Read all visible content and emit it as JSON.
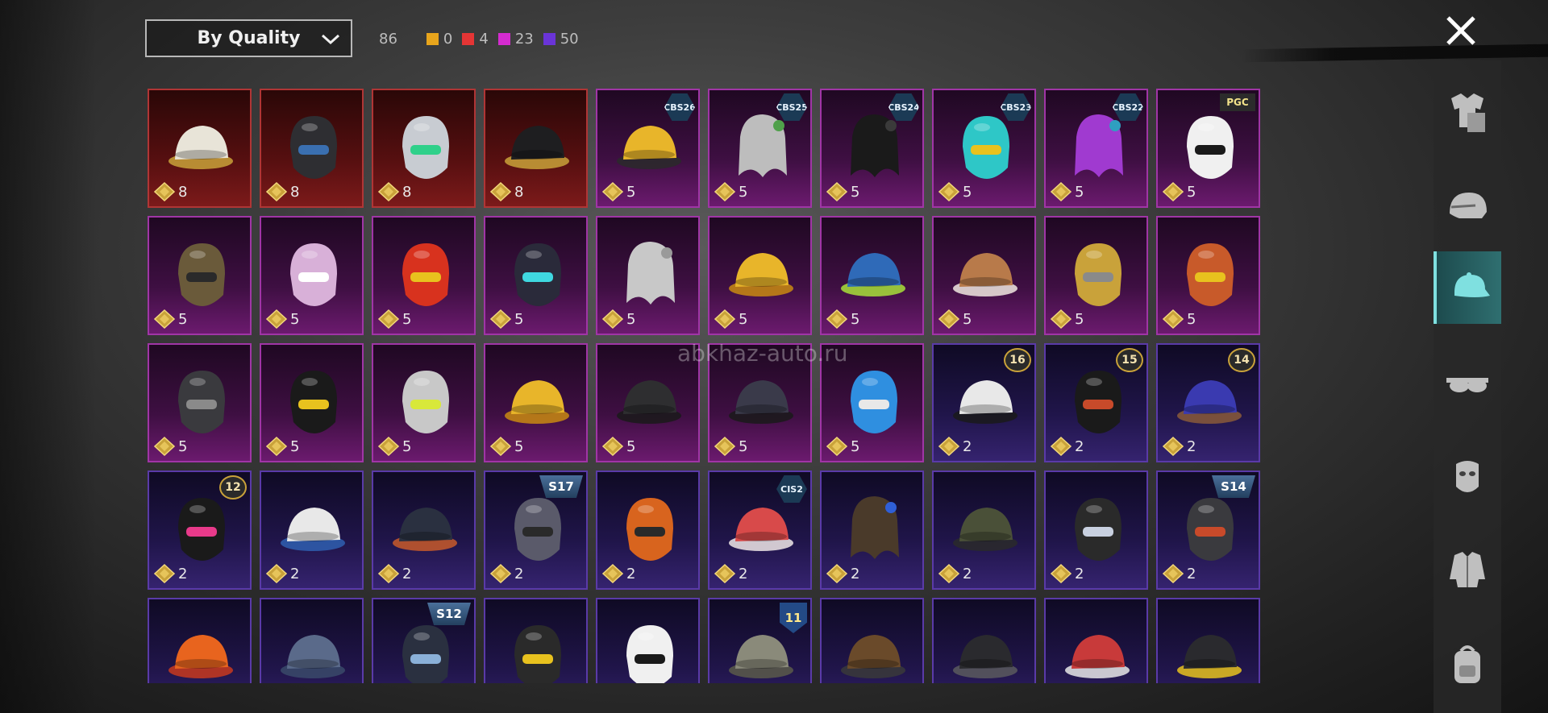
{
  "sort": {
    "label": "By Quality"
  },
  "stats": {
    "total": "86",
    "items": [
      {
        "color": "#e8a51c",
        "count": "0"
      },
      {
        "color": "#e53535",
        "count": "4"
      },
      {
        "color": "#d42bd0",
        "count": "23"
      },
      {
        "color": "#6a34d8",
        "count": "50"
      }
    ]
  },
  "watermark": "abkhaz-auto.ru",
  "rail": [
    {
      "name": "outfit-icon",
      "active": false
    },
    {
      "name": "helmet-icon",
      "active": false
    },
    {
      "name": "cap-icon",
      "active": true
    },
    {
      "name": "goggles-icon",
      "active": false
    },
    {
      "name": "mask-icon",
      "active": false
    },
    {
      "name": "jacket-icon",
      "active": false
    },
    {
      "name": "backpack-icon",
      "active": false
    }
  ],
  "items": [
    {
      "tier": "red",
      "qty": "8",
      "icon": "cowboy-hat",
      "color": "#e8e4d8",
      "accent": "#c9a23a",
      "badge": null
    },
    {
      "tier": "red",
      "qty": "8",
      "icon": "tactical-helmet",
      "color": "#2e2e32",
      "accent": "#3a6fb0",
      "badge": null
    },
    {
      "tier": "red",
      "qty": "8",
      "icon": "knight-helmet",
      "color": "#c8ccd2",
      "accent": "#2fd08a",
      "badge": null
    },
    {
      "tier": "red",
      "qty": "8",
      "icon": "bicorne-hat",
      "color": "#1e1e20",
      "accent": "#c9a23a",
      "badge": null
    },
    {
      "tier": "pink",
      "qty": "5",
      "icon": "bee-hat",
      "color": "#e8b52a",
      "accent": "#2a2a2a",
      "badge": {
        "type": "hex",
        "text": "CBS26"
      }
    },
    {
      "tier": "pink",
      "qty": "5",
      "icon": "silver-hair",
      "color": "#bdbdbd",
      "accent": "#4fa04a",
      "badge": {
        "type": "hex",
        "text": "CBS25"
      }
    },
    {
      "tier": "pink",
      "qty": "5",
      "icon": "black-hair",
      "color": "#1a1a1a",
      "accent": "#3a3a3a",
      "badge": {
        "type": "hex",
        "text": "CBS24"
      }
    },
    {
      "tier": "pink",
      "qty": "5",
      "icon": "cat-headphones",
      "color": "#2ec7c7",
      "accent": "#e8c21e",
      "badge": {
        "type": "hex",
        "text": "CBS23"
      }
    },
    {
      "tier": "pink",
      "qty": "5",
      "icon": "purple-hair",
      "color": "#a03ad0",
      "accent": "#2f9fc0",
      "badge": {
        "type": "hex",
        "text": "CBS22"
      }
    },
    {
      "tier": "pink",
      "qty": "5",
      "icon": "panda-mask",
      "color": "#f0f0f0",
      "accent": "#1a1a1a",
      "badge": {
        "type": "pgc",
        "text": "PGC"
      }
    },
    {
      "tier": "pink",
      "qty": "5",
      "icon": "feather-ornament",
      "color": "#6a5a3a",
      "accent": "#2a2a2a",
      "badge": null
    },
    {
      "tier": "pink",
      "qty": "5",
      "icon": "bunny-hood",
      "color": "#d8b0d8",
      "accent": "#ffffff",
      "badge": null
    },
    {
      "tier": "pink",
      "qty": "5",
      "icon": "samurai-helmet",
      "color": "#d8321e",
      "accent": "#e8c21e",
      "badge": null
    },
    {
      "tier": "pink",
      "qty": "5",
      "icon": "crystal-headpiece",
      "color": "#2a2a3a",
      "accent": "#3fd8e0",
      "badge": null
    },
    {
      "tier": "pink",
      "qty": "5",
      "icon": "gray-long-hair",
      "color": "#c8c8c8",
      "accent": "#9a9a9a",
      "badge": null
    },
    {
      "tier": "pink",
      "qty": "5",
      "icon": "yellow-bucket-hat",
      "color": "#e8b52a",
      "accent": "#c98a12",
      "badge": null
    },
    {
      "tier": "pink",
      "qty": "5",
      "icon": "frog-hat",
      "color": "#2f6ab8",
      "accent": "#a8e03a",
      "badge": null
    },
    {
      "tier": "pink",
      "qty": "5",
      "icon": "bear-beanie",
      "color": "#b87a4a",
      "accent": "#f0e8e0",
      "badge": null
    },
    {
      "tier": "pink",
      "qty": "5",
      "icon": "golden-mask-helmet",
      "color": "#c9a23a",
      "accent": "#8a8a8a",
      "badge": null
    },
    {
      "tier": "pink",
      "qty": "5",
      "icon": "red-turban",
      "color": "#c85a2a",
      "accent": "#e8c21e",
      "badge": null
    },
    {
      "tier": "pink",
      "qty": "5",
      "icon": "armored-helmet",
      "color": "#3a3a3e",
      "accent": "#8a8a8a",
      "badge": null
    },
    {
      "tier": "pink",
      "qty": "5",
      "icon": "cat-king-helmet",
      "color": "#1a1a1a",
      "accent": "#e8c21e",
      "badge": null
    },
    {
      "tier": "pink",
      "qty": "5",
      "icon": "ponytail-goggles",
      "color": "#c8c8c8",
      "accent": "#d8e83a",
      "badge": null
    },
    {
      "tier": "pink",
      "qty": "5",
      "icon": "yellow-bucket-hat-2",
      "color": "#e8b52a",
      "accent": "#c98a12",
      "badge": null
    },
    {
      "tier": "pink",
      "qty": "5",
      "icon": "witch-hat",
      "color": "#2e2e30",
      "accent": "#1a1a1a",
      "badge": null
    },
    {
      "tier": "pink",
      "qty": "5",
      "icon": "spiky-hair-cap",
      "color": "#3a3a4a",
      "accent": "#1a1a1a",
      "badge": null
    },
    {
      "tier": "pink",
      "qty": "5",
      "icon": "blue-spiky-mask",
      "color": "#2f8fe0",
      "accent": "#e8e8e8",
      "badge": null
    },
    {
      "tier": "purple",
      "qty": "2",
      "icon": "snow-beanie",
      "color": "#e8e8e8",
      "accent": "#1a1a1a",
      "badge": {
        "type": "num",
        "text": "16"
      }
    },
    {
      "tier": "purple",
      "qty": "2",
      "icon": "pumpkin-hood",
      "color": "#1a1a1a",
      "accent": "#c84a2a",
      "badge": {
        "type": "num",
        "text": "15"
      }
    },
    {
      "tier": "purple",
      "qty": "2",
      "icon": "cap-long-hair",
      "color": "#3a3ab0",
      "accent": "#8a5a3a",
      "badge": {
        "type": "num",
        "text": "14"
      }
    },
    {
      "tier": "purple",
      "qty": "2",
      "icon": "bunny-ears-helmet",
      "color": "#1a1a1a",
      "accent": "#e83a8a",
      "badge": {
        "type": "num",
        "text": "12"
      }
    },
    {
      "tier": "purple",
      "qty": "2",
      "icon": "baseball-cap",
      "color": "#e8e8e8",
      "accent": "#2f5fb0",
      "badge": null
    },
    {
      "tier": "purple",
      "qty": "2",
      "icon": "navy-beanie",
      "color": "#2a3040",
      "accent": "#c85a2a",
      "badge": null
    },
    {
      "tier": "purple",
      "qty": "2",
      "icon": "horned-helmet",
      "color": "#5a5a6a",
      "accent": "#2a2a2a",
      "badge": {
        "type": "season",
        "text": "S17"
      }
    },
    {
      "tier": "purple",
      "qty": "2",
      "icon": "pumpkin-mask",
      "color": "#d8641e",
      "accent": "#2a2a2a",
      "badge": null
    },
    {
      "tier": "purple",
      "qty": "2",
      "icon": "striped-beanie",
      "color": "#d84a4a",
      "accent": "#f0e8e8",
      "badge": {
        "type": "hex",
        "text": "CIS2"
      }
    },
    {
      "tier": "purple",
      "qty": "2",
      "icon": "brown-hair",
      "color": "#4a3a2a",
      "accent": "#2f5fd8",
      "badge": null
    },
    {
      "tier": "purple",
      "qty": "2",
      "icon": "military-cap",
      "color": "#4a5038",
      "accent": "#2a2a2a",
      "badge": null
    },
    {
      "tier": "purple",
      "qty": "2",
      "icon": "ski-goggles",
      "color": "#2a2a2a",
      "accent": "#c8d0e0",
      "badge": null
    },
    {
      "tier": "purple",
      "qty": "2",
      "icon": "spartan-helmet",
      "color": "#3a3a3e",
      "accent": "#c84a2a",
      "badge": {
        "type": "season",
        "text": "S14"
      }
    },
    {
      "tier": "purple",
      "qty": "",
      "icon": "orange-cap",
      "color": "#e8641e",
      "accent": "#c83a1e",
      "badge": null
    },
    {
      "tier": "purple",
      "qty": "",
      "icon": "camo-beret",
      "color": "#5a6a8a",
      "accent": "#3a4a6a",
      "badge": null
    },
    {
      "tier": "purple",
      "qty": "",
      "icon": "space-helmet",
      "color": "#2a3040",
      "accent": "#8ab0d8",
      "badge": {
        "type": "season",
        "text": "S12"
      }
    },
    {
      "tier": "purple",
      "qty": "",
      "icon": "headset",
      "color": "#2a2a2a",
      "accent": "#e8c21e",
      "badge": null
    },
    {
      "tier": "purple",
      "qty": "",
      "icon": "polar-bear-hood",
      "color": "#f0f0f0",
      "accent": "#1a1a1a",
      "badge": null
    },
    {
      "tier": "purple",
      "qty": "",
      "icon": "camo-boonie-hat",
      "color": "#8a8a7a",
      "accent": "#5a5a4a",
      "badge": {
        "type": "shield",
        "text": "11"
      }
    },
    {
      "tier": "purple",
      "qty": "",
      "icon": "aviator-cap",
      "color": "#6a4a2a",
      "accent": "#3a3a3a",
      "badge": null
    },
    {
      "tier": "purple",
      "qty": "",
      "icon": "black-cap",
      "color": "#2a2a2e",
      "accent": "#5a5a5e",
      "badge": null
    },
    {
      "tier": "purple",
      "qty": "",
      "icon": "red-beanie",
      "color": "#c83a3a",
      "accent": "#e8e8e8",
      "badge": null
    },
    {
      "tier": "purple",
      "qty": "",
      "icon": "knit-beanie",
      "color": "#2a2a2e",
      "accent": "#e8c21e",
      "badge": null
    }
  ]
}
